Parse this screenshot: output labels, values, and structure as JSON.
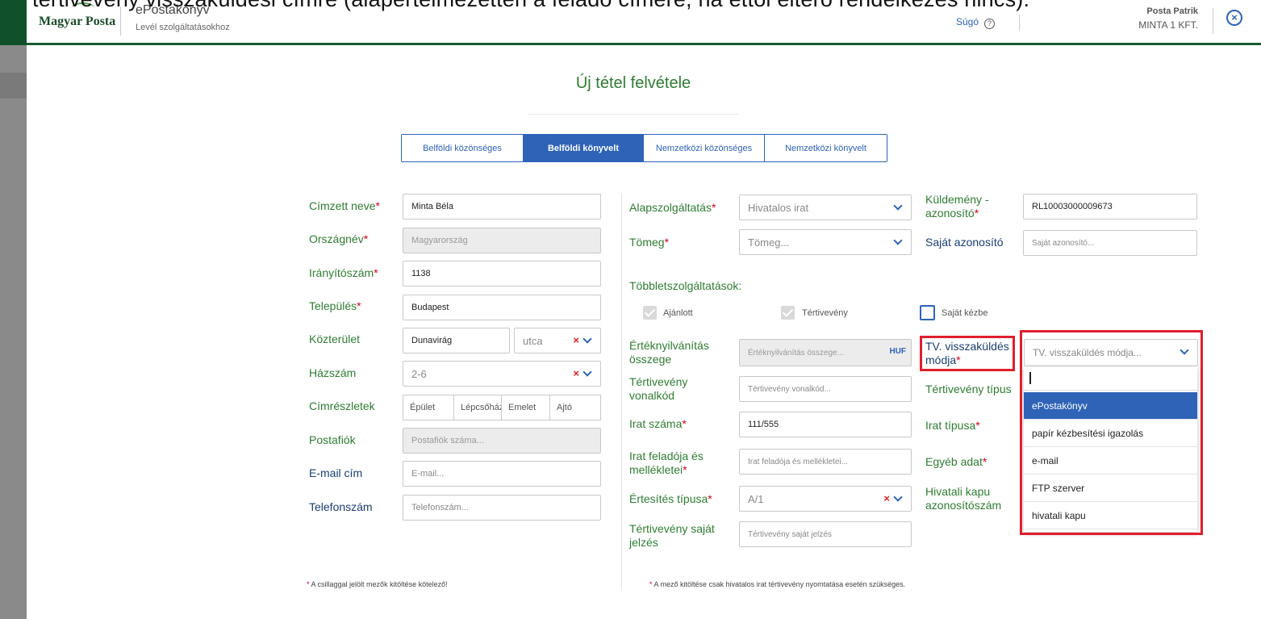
{
  "overlay_caption": "tértivevény visszaküldési címre (alapértelmezetten a feladó címére, ha ettől eltérő rendelkezés nincs).",
  "header": {
    "logo": "Magyar Posta",
    "app_name": "ePostakönyv",
    "app_sub": "Levél szolgáltatásokhoz",
    "help": "Súgó",
    "user_name": "Posta Patrik",
    "user_org": "MINTA 1 KFT."
  },
  "page": {
    "title": "Új tétel felvétele"
  },
  "tabs": [
    "Belföldi közönséges",
    "Belföldi könyvelt",
    "Nemzetközi közönséges",
    "Nemzetközi könyvelt"
  ],
  "left": {
    "recipient_label": "Címzett neve",
    "recipient_value": "Minta Béla",
    "country_label": "Országnév",
    "country_value": "Magyarország",
    "zip_label": "Irányítószám",
    "zip_value": "1138",
    "city_label": "Település",
    "city_value": "Budapest",
    "street_label": "Közterület",
    "street_value": "Dunavirág",
    "street_type": "utca",
    "house_label": "Házszám",
    "house_value": "2-6",
    "address_details_label": "Címrészletek",
    "address_parts": [
      "Épület",
      "Lépcsőház",
      "Emelet",
      "Ajtó"
    ],
    "pobox_label": "Postafiók",
    "pobox_placeholder": "Postafiók száma...",
    "email_label": "E-mail cím",
    "email_placeholder": "E-mail...",
    "phone_label": "Telefonszám",
    "phone_placeholder": "Telefonszám..."
  },
  "middle": {
    "base_service_label": "Alapszolgáltatás",
    "base_service_value": "Hivatalos irat",
    "weight_label": "Tömeg",
    "weight_placeholder": "Tömeg...",
    "extra_services_label": "Többletszolgáltatások:",
    "cb_registered": "Ajánlott",
    "cb_return_receipt": "Tértivevény",
    "cb_own_hands": "Saját kézbe",
    "declared_value_label_1": "Értéknyilvánítás",
    "declared_value_label_2": "összege",
    "declared_value_placeholder": "Értéknyilvánítás összege...",
    "currency": "HUF",
    "rr_barcode_label_1": "Tértivevény",
    "rr_barcode_label_2": "vonalkód",
    "rr_barcode_placeholder": "Tértivevény vonalkód...",
    "doc_number_label": "Irat száma",
    "doc_number_value": "111/555",
    "doc_sender_label_1": "Irat feladója és",
    "doc_sender_label_2": "mellékletei",
    "doc_sender_placeholder": "Irat feladója és mellékletei...",
    "notif_type_label": "Értesítés típusa",
    "notif_type_value": "A/1",
    "rr_own_label_1": "Tértivevény saját",
    "rr_own_label_2": "jelzés",
    "rr_own_placeholder": "Tértivevény saját jelzés"
  },
  "right": {
    "item_id_label_1": "Küldemény -",
    "item_id_label_2": "azonosító",
    "item_id_value": "RL10003000009673",
    "own_id_label": "Saját azonosító",
    "own_id_placeholder": "Saját azonosító...",
    "tv_return_label_1": "TV. visszaküldés",
    "tv_return_label_2": "módja",
    "tv_return_placeholder": "TV. visszaküldés módja...",
    "rr_type_label": "Tértivevény típus",
    "doc_type_label": "Irat típusa",
    "other_data_label": "Egyéb adat",
    "gov_gate_label_1": "Hivatali kapu",
    "gov_gate_label_2": "azonosítószám"
  },
  "dropdown_options": [
    "ePostakönyv",
    "papír kézbesítési igazolás",
    "e-mail",
    "FTP szerver",
    "hivatali kapu"
  ],
  "notes": {
    "left_text": " A csillaggal jelölt mezők kitöltése kötelező!",
    "right_text": " A mező kitöltése csak hivatalos irat tértivevény nyomtatása esetén szükséges."
  },
  "colors": {
    "brand_green": "#2e7d32",
    "accent_blue": "#2e63b7",
    "highlight_red": "#e01f2d"
  }
}
